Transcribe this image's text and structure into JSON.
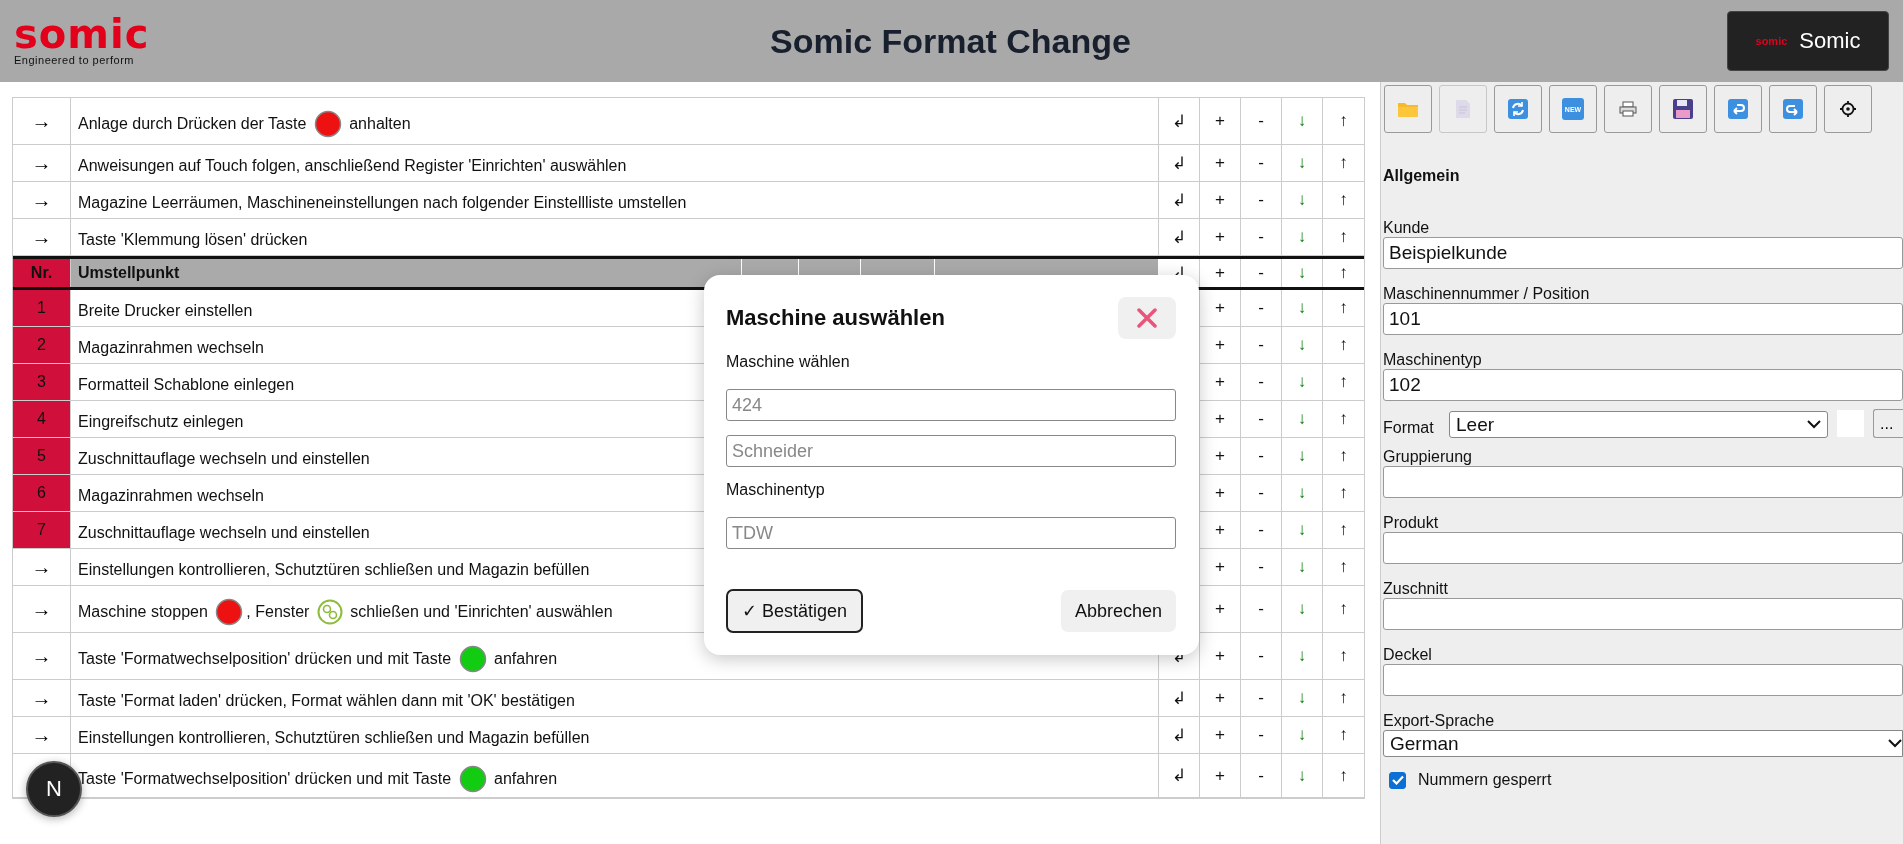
{
  "header": {
    "logo": {
      "wordmark": "somic",
      "tagline": "Engineered to perform"
    },
    "title": "Somic Format Change",
    "user_button": {
      "logo": "somic",
      "label": "Somic"
    }
  },
  "table": {
    "rows": [
      {
        "kind": "step",
        "marker": "→",
        "parts": [
          {
            "kind": "text",
            "text": "Anlage durch Drücken der Taste "
          },
          {
            "kind": "lamp",
            "color": "#ee1111"
          },
          {
            "kind": "text",
            "text": " anhalten"
          }
        ],
        "actions": [
          "↲",
          "+",
          "-",
          "↓",
          "↑"
        ]
      },
      {
        "kind": "step",
        "marker": "→",
        "parts": [
          {
            "kind": "text",
            "text": "Anweisungen auf Touch folgen, anschließend Register 'Einrichten' auswählen"
          }
        ],
        "actions": [
          "↲",
          "+",
          "-",
          "↓",
          "↑"
        ]
      },
      {
        "kind": "step",
        "marker": "→",
        "parts": [
          {
            "kind": "text",
            "text": "Magazine Leerräumen, Maschineneinstellungen nach folgender Einstellliste umstellen"
          }
        ],
        "actions": [
          "↲",
          "+",
          "-",
          "↓",
          "↑"
        ]
      },
      {
        "kind": "step",
        "marker": "→",
        "parts": [
          {
            "kind": "text",
            "text": "Taste 'Klemmung lösen' drücken"
          }
        ],
        "actions": [
          "↲",
          "+",
          "-",
          "↓",
          "↑"
        ]
      },
      {
        "kind": "columns",
        "cells": [
          "Nr.",
          "Umstellpunkt"
        ],
        "actions": [
          "↲",
          "+",
          "-",
          "↓",
          "↑"
        ]
      },
      {
        "kind": "numbered",
        "number": "1",
        "parts": [
          {
            "kind": "text",
            "text": "Breite Drucker einstellen"
          }
        ],
        "actions": [
          "+",
          "-",
          "↓",
          "↑"
        ]
      },
      {
        "kind": "numbered",
        "number": "2",
        "parts": [
          {
            "kind": "text",
            "text": "Magazinrahmen wechseln"
          }
        ],
        "actions": [
          "+",
          "-",
          "↓",
          "↑"
        ]
      },
      {
        "kind": "numbered",
        "number": "3",
        "parts": [
          {
            "kind": "text",
            "text": "Formatteil Schablone einlegen"
          }
        ],
        "actions": [
          "+",
          "-",
          "↓",
          "↑"
        ]
      },
      {
        "kind": "numbered",
        "number": "4",
        "parts": [
          {
            "kind": "text",
            "text": "Eingreifschutz einlegen"
          }
        ],
        "actions": [
          "+",
          "-",
          "↓",
          "↑"
        ]
      },
      {
        "kind": "numbered",
        "number": "5",
        "parts": [
          {
            "kind": "text",
            "text": "Zuschnittauflage wechseln und einstellen"
          }
        ],
        "actions": [
          "+",
          "-",
          "↓",
          "↑"
        ]
      },
      {
        "kind": "numbered",
        "number": "6",
        "parts": [
          {
            "kind": "text",
            "text": "Magazinrahmen wechseln"
          }
        ],
        "actions": [
          "+",
          "-",
          "↓",
          "↑"
        ]
      },
      {
        "kind": "numbered",
        "number": "7",
        "parts": [
          {
            "kind": "text",
            "text": "Zuschnittauflage wechseln und einstellen"
          }
        ],
        "actions": [
          "+",
          "-",
          "↓",
          "↑"
        ]
      },
      {
        "kind": "step",
        "marker": "→",
        "parts": [
          {
            "kind": "text",
            "text": "Einstellungen kontrollieren, Schutztüren schließen und Magazin befüllen"
          }
        ],
        "actions": [
          "+",
          "-",
          "↓",
          "↑"
        ]
      },
      {
        "kind": "step",
        "marker": "→",
        "parts": [
          {
            "kind": "text",
            "text": "Maschine stoppen "
          },
          {
            "kind": "lamp",
            "color": "#ee1111"
          },
          {
            "kind": "text",
            "text": ", Fenster "
          },
          {
            "kind": "window"
          },
          {
            "kind": "text",
            "text": " schließen und 'Einrichten' auswählen"
          }
        ],
        "actions": [
          "+",
          "-",
          "↓",
          "↑"
        ]
      },
      {
        "kind": "step",
        "marker": "→",
        "parts": [
          {
            "kind": "text",
            "text": "Taste 'Formatwechselposition' drücken und mit Taste "
          },
          {
            "kind": "lamp",
            "color": "#11cc11"
          },
          {
            "kind": "text",
            "text": " anfahren"
          }
        ],
        "actions": [
          "↲",
          "+",
          "-",
          "↓",
          "↑"
        ]
      },
      {
        "kind": "step",
        "marker": "→",
        "parts": [
          {
            "kind": "text",
            "text": "Taste 'Format laden' drücken, Format wählen dann mit 'OK' bestätigen"
          }
        ],
        "actions": [
          "↲",
          "+",
          "-",
          "↓",
          "↑"
        ]
      },
      {
        "kind": "step",
        "marker": "→",
        "parts": [
          {
            "kind": "text",
            "text": "Einstellungen kontrollieren, Schutztüren schließen und Magazin befüllen"
          }
        ],
        "actions": [
          "↲",
          "+",
          "-",
          "↓",
          "↑"
        ]
      },
      {
        "kind": "step",
        "marker": "",
        "parts": [
          {
            "kind": "text",
            "text": "Taste 'Formatwechselposition' drücken und mit Taste "
          },
          {
            "kind": "lamp",
            "color": "#11cc11"
          },
          {
            "kind": "text",
            "text": " anfahren"
          }
        ],
        "actions": [
          "↲",
          "+",
          "-",
          "↓",
          "↑"
        ]
      }
    ]
  },
  "sidebar": {
    "toolbar": [
      {
        "kind": "open",
        "disabled": false
      },
      {
        "kind": "document",
        "disabled": true
      },
      {
        "kind": "refresh",
        "disabled": false
      },
      {
        "kind": "new",
        "label": "NEW",
        "disabled": false
      },
      {
        "kind": "print",
        "disabled": false
      },
      {
        "kind": "save",
        "disabled": false
      },
      {
        "kind": "undo",
        "disabled": false
      },
      {
        "kind": "redo",
        "disabled": false
      },
      {
        "kind": "settings",
        "disabled": false
      }
    ],
    "section_title": "Allgemein",
    "fields": [
      {
        "kind": "text",
        "label": "Kunde",
        "value": "Beispielkunde"
      },
      {
        "kind": "text",
        "label": "Maschinennummer / Position",
        "value": "101"
      },
      {
        "kind": "text",
        "label": "Maschinentyp",
        "value": "102"
      },
      {
        "kind": "format",
        "label": "Format",
        "value": "Leer",
        "button": "..."
      },
      {
        "kind": "text",
        "label": "Gruppierung"
      },
      {
        "kind": "text",
        "label": "Produkt"
      },
      {
        "kind": "text",
        "label": "Zuschnitt"
      },
      {
        "kind": "text",
        "label": "Deckel"
      },
      {
        "kind": "select",
        "label": "Export-Sprache",
        "value": "German"
      }
    ],
    "checkbox": {
      "label": "Nummern gesperrt",
      "checked": true
    }
  },
  "dialog": {
    "title": "Maschine auswählen",
    "fields": [
      {
        "kind": "label",
        "text": "Maschine wählen"
      },
      {
        "kind": "input",
        "placeholder": "424"
      },
      {
        "kind": "input",
        "placeholder": "Schneider"
      },
      {
        "kind": "label",
        "text": "Maschinentyp"
      },
      {
        "kind": "input",
        "placeholder": "TDW"
      }
    ],
    "confirm": "✓ Bestätigen",
    "cancel": "Abbrechen"
  },
  "dev_badge": {
    "label": "N"
  }
}
